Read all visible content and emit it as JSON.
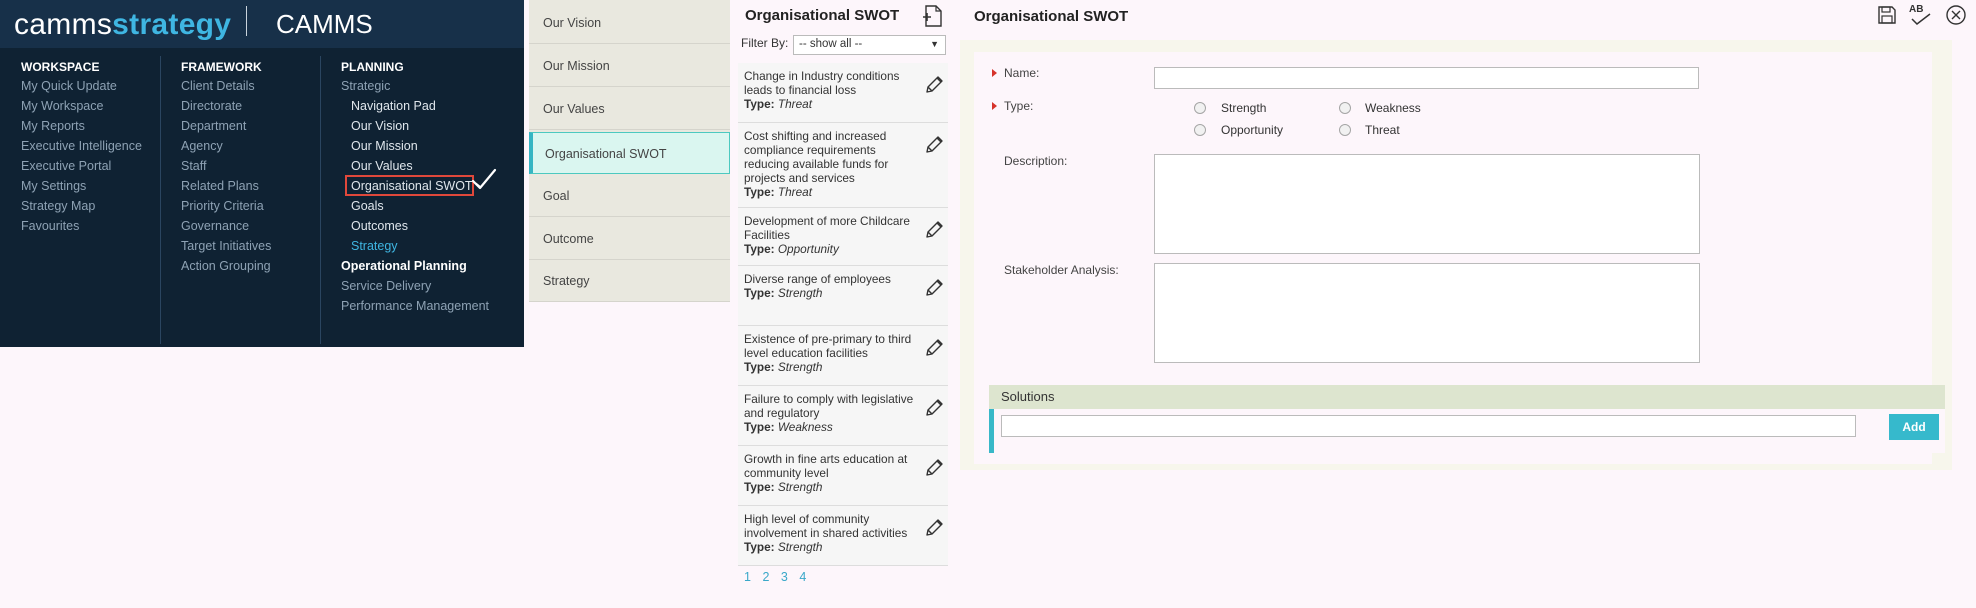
{
  "nav": {
    "logo_part1": "camms",
    "logo_part2": "strategy",
    "brand": "CAMMS",
    "workspace": {
      "title": "WORKSPACE",
      "items": [
        "My Quick Update",
        "My Workspace",
        "My Reports",
        "Executive Intelligence",
        "Executive Portal",
        "My Settings",
        "Strategy Map",
        "Favourites"
      ]
    },
    "framework": {
      "title": "FRAMEWORK",
      "items": [
        "Client Details",
        "Directorate",
        "Department",
        "Agency",
        "Staff",
        "Related Plans",
        "Priority Criteria",
        "Governance",
        "Target Initiatives",
        "Action Grouping"
      ]
    },
    "planning": {
      "title": "PLANNING",
      "strategic": "Strategic",
      "sub_items": [
        "Navigation Pad",
        "Our Vision",
        "Our Mission",
        "Our Values",
        "Organisational SWOT",
        "Goals",
        "Outcomes",
        "Strategy"
      ],
      "operational": "Operational Planning",
      "service_delivery": "Service Delivery",
      "performance": "Performance Management"
    }
  },
  "tabs": [
    "Our Vision",
    "Our Mission",
    "Our Values",
    "Organisational SWOT",
    "Goal",
    "Outcome",
    "Strategy"
  ],
  "list": {
    "title": "Organisational SWOT",
    "filter_label": "Filter By:",
    "filter_value": "-- show all --",
    "type_label": "Type:",
    "items": [
      {
        "text": "Change in Industry conditions leads to financial loss",
        "type": "Threat"
      },
      {
        "text": "Cost shifting and increased compliance requirements reducing available funds for projects and services",
        "type": "Threat"
      },
      {
        "text": "Development of more Childcare Facilities",
        "type": "Opportunity"
      },
      {
        "text": "Diverse range of employees",
        "type": "Strength"
      },
      {
        "text": "Existence of pre-primary to third level education facilities",
        "type": "Strength"
      },
      {
        "text": "Failure to comply with legislative and regulatory",
        "type": "Weakness"
      },
      {
        "text": "Growth in fine arts education at community level",
        "type": "Strength"
      },
      {
        "text": "High level of community involvement in shared activities",
        "type": "Strength"
      }
    ],
    "pages": [
      "1",
      "2",
      "3",
      "4"
    ]
  },
  "form": {
    "title": "Organisational SWOT",
    "name_label": "Name:",
    "type_label": "Type:",
    "options": [
      "Strength",
      "Weakness",
      "Opportunity",
      "Threat"
    ],
    "description_label": "Description:",
    "stakeholder_label": "Stakeholder Analysis:",
    "solutions_label": "Solutions",
    "add_label": "Add",
    "spellcheck_label": "AB"
  },
  "colors": {
    "nav_bg": "#0f2233",
    "accent": "#36b9cc",
    "highlight": "#e0483b"
  }
}
